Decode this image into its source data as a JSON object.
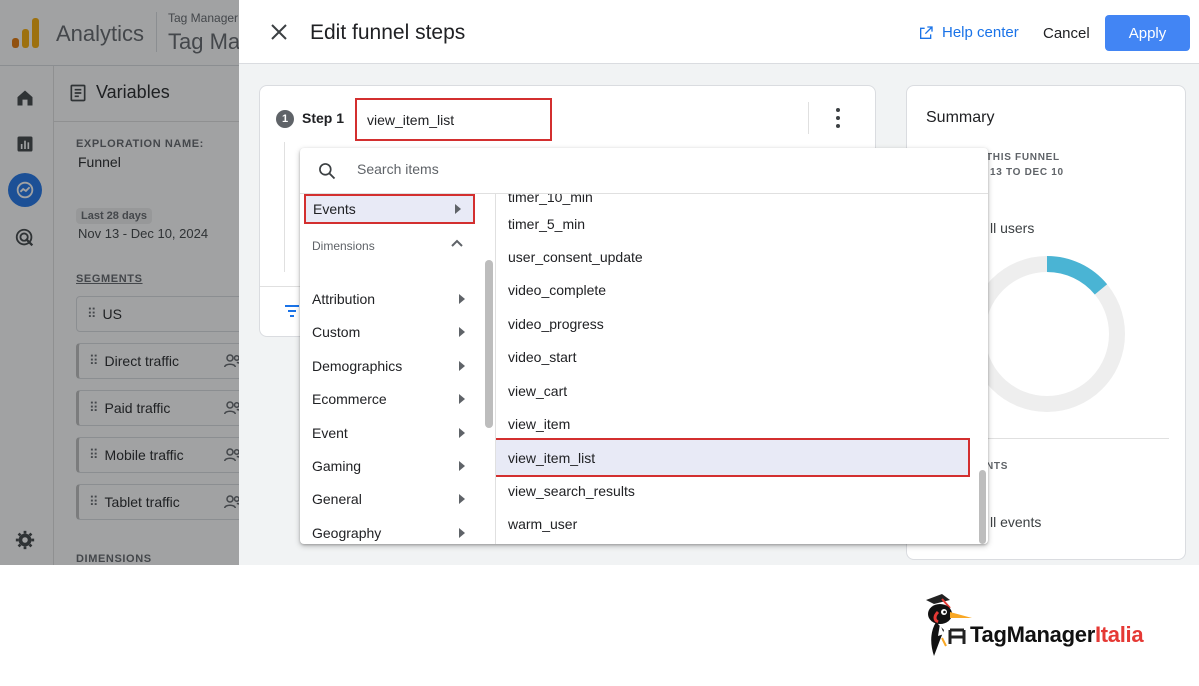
{
  "app": {
    "name": "Analytics",
    "product_small": "Tag Manager",
    "product_big": "Tag Ma",
    "brand_colors": {
      "orange": "#f9ab00",
      "deep_orange": "#e37400",
      "blue": "#1a73e8"
    }
  },
  "leftnav": {
    "items": [
      {
        "icon": "home-icon"
      },
      {
        "icon": "reports-icon"
      },
      {
        "icon": "explore-icon",
        "active": true
      },
      {
        "icon": "advertising-icon"
      },
      {
        "icon": "settings-gear-icon"
      }
    ]
  },
  "variables": {
    "title": "Variables",
    "exploration_name_label": "EXPLORATION NAME:",
    "exploration_name": "Funnel",
    "date_chip": "Last 28 days",
    "date_range": "Nov 13 - Dec 10, 2024",
    "segments_label": "SEGMENTS",
    "segments": [
      "US",
      "Direct traffic",
      "Paid traffic",
      "Mobile traffic",
      "Tablet traffic"
    ],
    "dimensions_label": "DIMENSIONS"
  },
  "drawer": {
    "title": "Edit funnel steps",
    "help_center": "Help center",
    "cancel": "Cancel",
    "apply": "Apply",
    "accent": "#4285f4",
    "highlight": "#d32f2f"
  },
  "step": {
    "number": "1",
    "label": "Step 1",
    "value": "view_item_list"
  },
  "summary": {
    "title": "Summary",
    "funnel_caps": "THIS FUNNEL",
    "date_caps": "13 TO DEC 10",
    "users_text": "ll users",
    "donut_fill_fraction": 0.14,
    "donut_color": "#4ab4d4",
    "events_caps": "NTS",
    "events_text": "ll events"
  },
  "menu": {
    "search_placeholder": "Search items",
    "selected_category": "Events",
    "dimensions_header": "Dimensions",
    "categories": [
      "Attribution",
      "Custom",
      "Demographics",
      "Ecommerce",
      "Event",
      "Gaming",
      "General",
      "Geography"
    ],
    "partial_event": "timer_10_min",
    "events": [
      "timer_5_min",
      "user_consent_update",
      "video_complete",
      "video_progress",
      "video_start",
      "view_cart",
      "view_item",
      "view_item_list",
      "view_search_results",
      "warm_user"
    ],
    "selected_event": "view_item_list"
  },
  "brand": {
    "text_main": "TagManager",
    "text_accent": "Italia"
  }
}
